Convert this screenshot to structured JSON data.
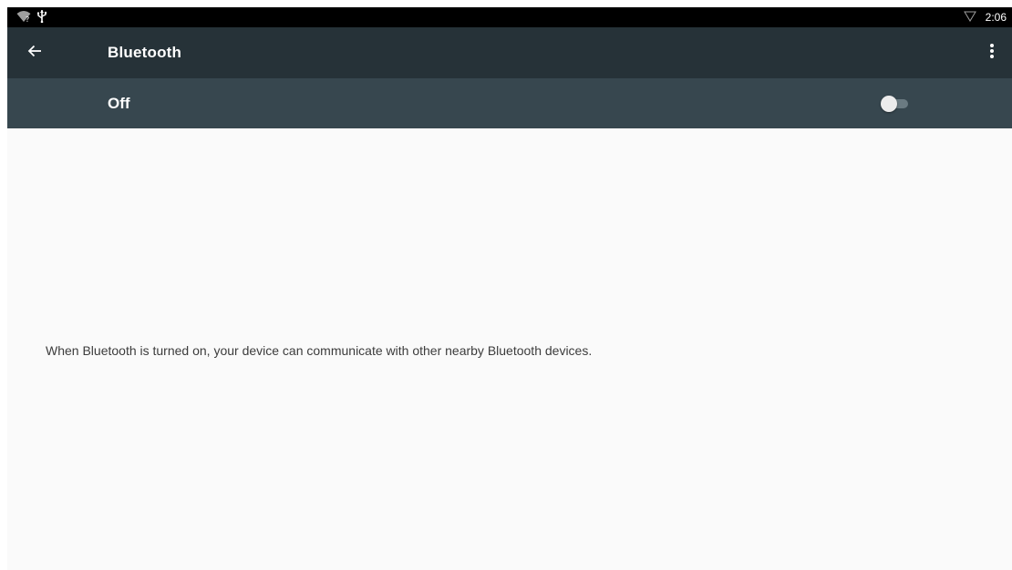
{
  "status_bar": {
    "left_icons": [
      "wifi-question-icon",
      "usb-icon"
    ],
    "right_icons": [
      "signal-outline-icon"
    ],
    "time": "2:06"
  },
  "toolbar": {
    "title": "Bluetooth",
    "back_icon": "arrow-back-icon",
    "overflow_icon": "more-vert-icon"
  },
  "switch_bar": {
    "label": "Off",
    "checked": false
  },
  "content": {
    "empty_message": "When Bluetooth is turned on, your device can communicate with other nearby Bluetooth devices."
  },
  "colors": {
    "status_bar": "#000000",
    "toolbar": "#263238",
    "switch_bar": "#37474f",
    "background": "#fafafa"
  }
}
